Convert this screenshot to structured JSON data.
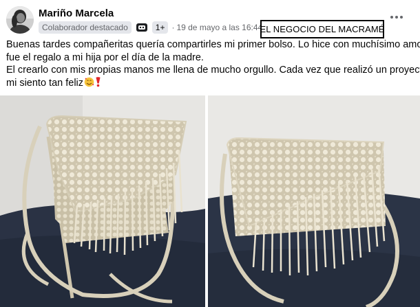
{
  "post": {
    "author": "Mariño Marcela",
    "badge": "Colaborador destacado",
    "badge_count": "1+",
    "separator": "·",
    "timestamp": "19 de mayo a las 16:44",
    "group_box": "EL NEGOCIO DEL MACRAMÉ",
    "text_lines": [
      "Buenas tardes compañeritas quería compartirles mi primer bolso. Lo hice con muchísimo amor",
      "fue el regalo a mi hija por el día de la madre.",
      "El  crearlo con mis propias manos me llena de mucho orgullo. Cada vez que realizó un proyecto",
      "mi siento tan feliz"
    ]
  },
  "icons": {
    "avatar": "profile-photo",
    "badge_icon": "chat-badge-icon",
    "privacy": "group-privacy-icon",
    "more": "more-options-icon",
    "emoji1": "smiling-face-with-hearts-emoji",
    "emoji2": "red-exclamation-emoji"
  },
  "colors": {
    "name": "#050505",
    "meta": "#65676b",
    "badge_bg": "#e4e6eb",
    "box_border": "#000000",
    "macrame": "#e3dcc8",
    "couch": "#2b3446",
    "wall": "#e9e8e5"
  }
}
